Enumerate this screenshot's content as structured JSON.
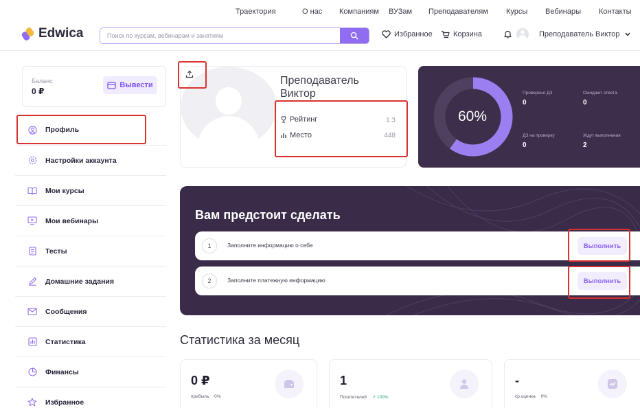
{
  "topnav": {
    "items": [
      "Траектория",
      "О нас",
      "Компаниям",
      "ВУЗам",
      "Преподавателям",
      "Курсы",
      "Вебинары",
      "Контакты"
    ]
  },
  "header": {
    "logo": "Edwica",
    "search_placeholder": "Поиск по курсам, вебинарам и занятиям",
    "favorites": "Избранное",
    "cart": "Корзина",
    "user_name": "Преподаватель Виктор"
  },
  "sidebar": {
    "balance_label": "Баланс",
    "balance_value": "0 ₽",
    "withdraw_label": "Вывести",
    "items": [
      {
        "label": "Профиль",
        "icon": "user-circle-icon"
      },
      {
        "label": "Настройки аккаунта",
        "icon": "gear-icon"
      },
      {
        "label": "Мои курсы",
        "icon": "book-icon"
      },
      {
        "label": "Мои вебинары",
        "icon": "monitor-play-icon"
      },
      {
        "label": "Тесты",
        "icon": "document-icon"
      },
      {
        "label": "Домашние задания",
        "icon": "pen-icon"
      },
      {
        "label": "Сообщения",
        "icon": "envelope-icon"
      },
      {
        "label": "Статистика",
        "icon": "bar-chart-icon"
      },
      {
        "label": "Финансы",
        "icon": "pie-clock-icon"
      },
      {
        "label": "Избранное",
        "icon": "star-icon"
      }
    ]
  },
  "profile": {
    "name": "Преподаватель Виктор",
    "rating_label": "Рейтинг",
    "rating_value": "1.3",
    "place_label": "Место",
    "place_value": "448"
  },
  "progress": {
    "percent_text": "60%",
    "percent": 60,
    "checked_label": "Проверено ДЗ",
    "checked_value": "0",
    "awaiting_label": "Ожидают ответа",
    "awaiting_value": "0",
    "to_check_label": "ДЗ на проверку",
    "to_check_value": "0",
    "waiting_exec_label": "Ждут выполнения",
    "waiting_exec_value": "2",
    "accent": "#9b7ff0"
  },
  "todo": {
    "title": "Вам предстоит сделать",
    "tasks": [
      {
        "num": "1",
        "text": "Заполните информацию о себе",
        "button": "Выполнить"
      },
      {
        "num": "2",
        "text": "Заполните платежную информацию",
        "button": "Выполнить"
      }
    ]
  },
  "month": {
    "title": "Статистика за месяц",
    "cards": [
      {
        "value": "0 ₽",
        "sub_label": "прибыль",
        "sub_change": "0%",
        "icon": "wallet-icon"
      },
      {
        "value": "1",
        "sub_label": "Посетителей",
        "sub_change": "↗ 100%",
        "icon": "person-icon"
      },
      {
        "value": "-",
        "sub_label": "ср.оценка",
        "sub_change": "0%",
        "icon": "trend-chart-icon"
      }
    ]
  },
  "colors": {
    "brand": "#8f6cf0",
    "dark_card": "#3a2b49",
    "highlight": "#d8322e",
    "positive": "#2aa876"
  }
}
